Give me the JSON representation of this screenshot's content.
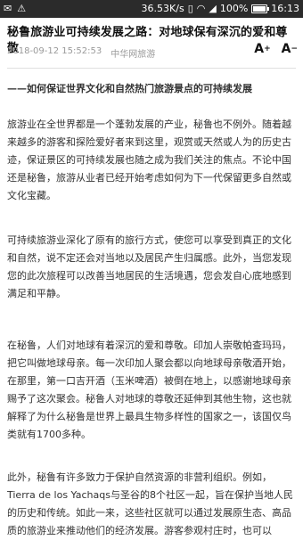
{
  "status": {
    "speed": "36.53K/s",
    "battery_pct": "100%",
    "time": "16:13",
    "battery_level": 1.0
  },
  "article": {
    "title": "秘鲁旅游业可持续发展之路：对地球保有深沉的爱和尊敬",
    "date": "2018-09-12 15:52:53",
    "source": "中华网旅游",
    "font_up": "A",
    "font_down": "A",
    "subheading": "——如何保证世界文化和自然热门旅游景点的可持续发展",
    "paragraphs": [
      "旅游业在全世界都是一个蓬勃发展的产业，秘鲁也不例外。随着越来越多的游客和探险爱好者来到这里，观赏或天然或人为的历史古迹，保证景区的可持续发展也随之成为我们关注的焦点。不论中国还是秘鲁，旅游从业者已经开始考虑如何为下一代保留更多自然或文化宝藏。",
      "可持续旅游业深化了原有的旅行方式，使您可以享受到真正的文化和自然，说不定还会对当地以及居民产生归属感。此外，当您发现您的此次旅程可以改善当地居民的生活境遇，您会发自心底地感到满足和平静。",
      "在秘鲁，人们对地球有着深沉的爱和尊敬。印加人崇敬帕查玛玛，把它叫做地球母亲。每一次印加人聚会都以向地球母亲敬酒开始，在那里，第一口吉开酒（玉米啤酒）被倒在地上，以感谢地球母亲赐予了这次聚会。秘鲁人对地球的尊敬还延伸到其他生物，这也就解释了为什么秘鲁是世界上最具生物多样性的国家之一，该国仅鸟类就有1700多种。",
      "此外，秘鲁有许多致力于保护自然资源的非营利组织。例如，Tierra de los Yachaqs与圣谷的8个社区一起，旨在保护当地人民的历史和传统。如此一来，这些社区就可以通过发展原生态、高品质的旅游业来推动他们的经济发展。游客参观村庄时，也可以"
    ]
  }
}
